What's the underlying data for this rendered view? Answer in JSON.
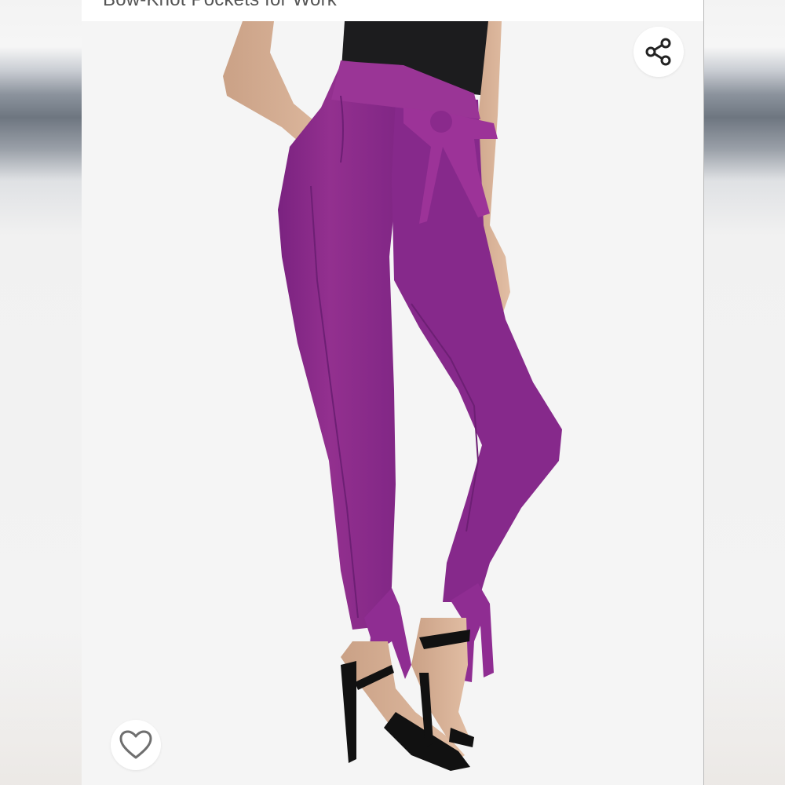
{
  "product": {
    "title": "Bow-Knot Pockets for Work",
    "image_alt": "Woman wearing high-waisted purple tie-waist pants with bow-knot ankle ties and black strappy heels",
    "pant_color": "#8c2a8f"
  },
  "actions": {
    "share_icon": "share-icon",
    "favorite_icon": "heart-outline-icon"
  }
}
